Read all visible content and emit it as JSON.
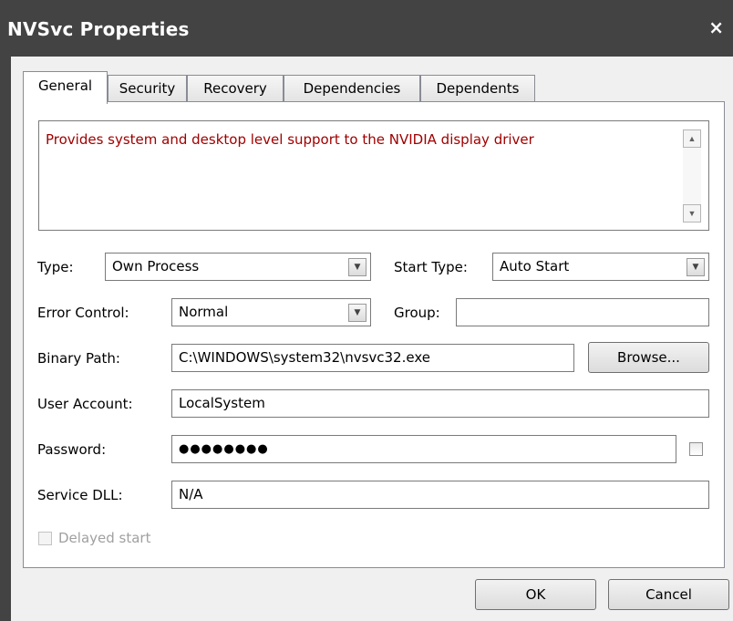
{
  "window": {
    "title": "NVSvc Properties",
    "close_glyph": "×"
  },
  "tabs": [
    {
      "label": "General",
      "active": true
    },
    {
      "label": "Security",
      "active": false
    },
    {
      "label": "Recovery",
      "active": false
    },
    {
      "label": "Dependencies",
      "active": false
    },
    {
      "label": "Dependents",
      "active": false
    }
  ],
  "general": {
    "description": "Provides system and desktop level support to the NVIDIA display driver",
    "type_label": "Type:",
    "type_value": "Own Process",
    "start_type_label": "Start Type:",
    "start_type_value": "Auto Start",
    "error_control_label": "Error Control:",
    "error_control_value": "Normal",
    "group_label": "Group:",
    "group_value": "",
    "binary_path_label": "Binary Path:",
    "binary_path_value": "C:\\WINDOWS\\system32\\nvsvc32.exe",
    "browse_label": "Browse...",
    "user_account_label": "User Account:",
    "user_account_value": "LocalSystem",
    "password_label": "Password:",
    "password_value": "●●●●●●●●",
    "service_dll_label": "Service DLL:",
    "service_dll_value": "N/A",
    "delayed_start_label": "Delayed start",
    "delayed_start_checked": false,
    "delayed_start_enabled": false
  },
  "footer": {
    "ok_label": "OK",
    "cancel_label": "Cancel"
  },
  "icons": {
    "scroll_up": "▲",
    "scroll_down": "▼",
    "dropdown": "▼"
  },
  "colors": {
    "titlebar": "#434343",
    "description_text": "#a00000",
    "client_background": "#f0f0f0"
  }
}
